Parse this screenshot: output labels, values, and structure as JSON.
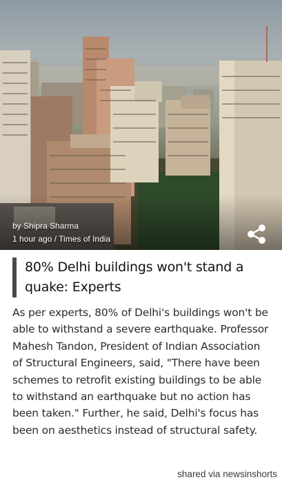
{
  "article": {
    "image_alt": "Delhi skyline with high-rise buildings",
    "author": "by Shipra Sharma",
    "meta": "1 hour ago / Times of India",
    "headline": "80% Delhi buildings won't stand a quake: Experts",
    "body": "As per experts, 80% of Delhi's buildings won't be able to withstand a severe earthquake. Professor Mahesh Tandon, President of Indian Association of Structural Engineers, said, \"There have been schemes to retrofit existing buildings to be able to withstand an earthquake but no action has been taken.\" Further, he said, Delhi's focus has been on aesthetics instead of structural safety."
  },
  "footer": {
    "text": "shared via newsinshorts"
  },
  "icons": {
    "share": "share-icon"
  },
  "colors": {
    "accent_bar": "#4a4a4a",
    "text": "#2b2b2b",
    "overlay_text": "#ffffff"
  }
}
